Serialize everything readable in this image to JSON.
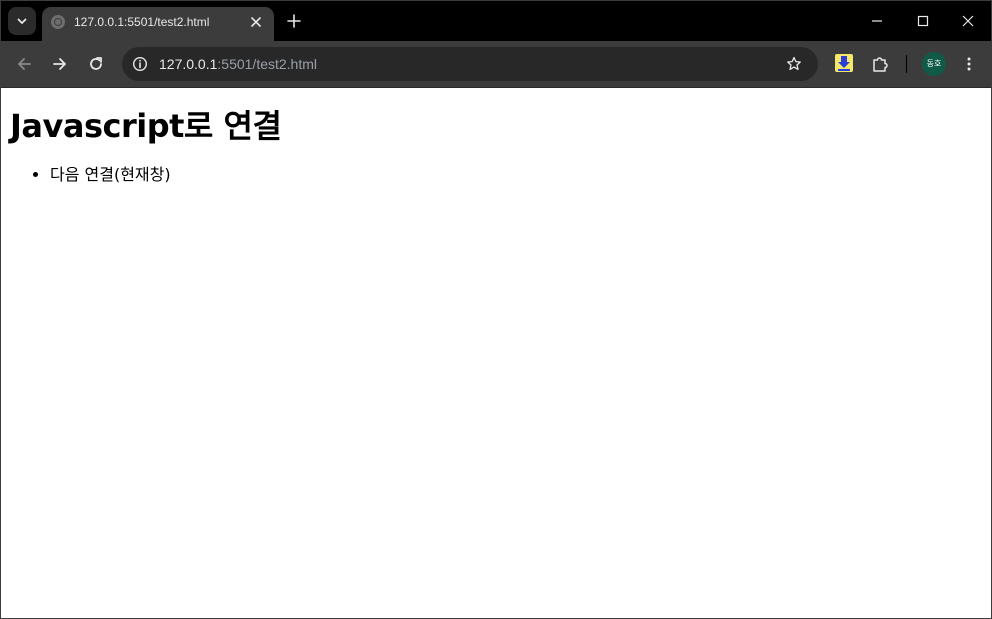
{
  "browser": {
    "tab": {
      "title": "127.0.0.1:5501/test2.html",
      "favicon": "globe-icon",
      "close_icon": "close-icon"
    },
    "new_tab_icon": "plus-icon",
    "window_controls": [
      "minimize-icon",
      "maximize-icon",
      "close-icon"
    ],
    "toolbar": {
      "back_icon": "arrow-left-icon",
      "forward_icon": "arrow-right-icon",
      "reload_icon": "reload-icon",
      "site_info_icon": "info-icon",
      "url_host": "127.0.0.1",
      "url_rest": ":5501/test2.html",
      "bookmark_icon": "star-icon",
      "extensions": [
        "download-extension-icon",
        "puzzle-icon"
      ],
      "profile_avatar_text": "동호",
      "menu_icon": "more-vertical-icon"
    },
    "colors": {
      "tabstrip_bg": "#000000",
      "toolbar_bg": "#3c3c3c",
      "omnibox_bg": "#282828",
      "avatar_bg": "#0f5a48"
    }
  },
  "page": {
    "heading": "Javascript로 연결",
    "links": [
      {
        "label": "다음 연결(현재창)"
      }
    ]
  }
}
